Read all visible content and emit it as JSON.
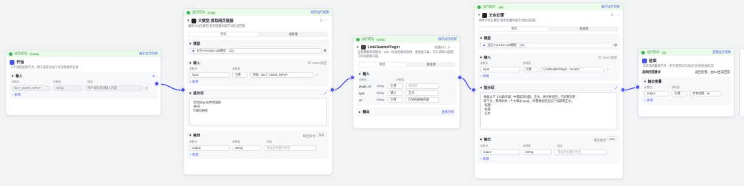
{
  "common": {
    "status": "运行成功",
    "show_result": "展示运行结果",
    "add": "新增",
    "tab_single": "单次",
    "tab_batch": "批处理",
    "col_name": "参数名",
    "col_type": "参数值",
    "col_value": "参数值",
    "col_desc": "描述",
    "inputs": "输入",
    "outputs": "输出",
    "prompt": "提示词",
    "model": "模型",
    "batch_label": "Batch类型"
  },
  "start": {
    "status_time": "0.004s",
    "title": "开始",
    "desc": "工作流的起始节点，用于设定启动工作流需要的信息",
    "section": "输入",
    "row": {
      "name": "BCT_USER_INPUT",
      "type": "String",
      "desc": "用户本轮对话输入内容"
    }
  },
  "llm1": {
    "status_time": "4.34s",
    "title": "大模型-提取网页链接",
    "desc": "调用大语言模型,使用变量和提示词生成回复",
    "model": "豆包·Function call模型",
    "model_tag": "32k",
    "input_row": {
      "name": "input",
      "mode": "引用",
      "ref": "开始 · BCT_USER_INPUT"
    },
    "prompt_text": [
      "识别{{input}}中的链接",
      "-要求:",
      "只输出链接"
    ],
    "output_label": "输出格式",
    "output_fmt": "text",
    "output_row": {
      "name": "output",
      "type": "String",
      "desc": "请描述变量的用途"
    }
  },
  "plugin": {
    "status_time": "4.03s",
    "title": "LinkReaderPlugin",
    "desc": "当你需要获取网页、pdf、抖音视频内容时，使用此工具。可以获取url链接下的标题和内容。",
    "rows": [
      {
        "name": "plugin_id",
        "type": "String",
        "val": "请选择"
      },
      {
        "name": "type",
        "type": "String",
        "val": "全文"
      },
      {
        "name": "url",
        "type": "String",
        "val": "识别的链接内容"
      }
    ],
    "output_link": "查看示例",
    "mode_label": "批量执行"
  },
  "llm2": {
    "status_time": "18s",
    "title": "文本处理",
    "desc": "调用大语言模型,使用变量和提示词生成回复",
    "model": "豆包·Function call模型",
    "model_tag": "32k",
    "input_row": {
      "name": "input",
      "mode": "引用",
      "ref": "LinkReaderPlugin - content"
    },
    "prompt_text": [
      "根据以下【文章内容】中提取其标题、正文、要点并返回，告诉我先吧",
      "除下文，我将给你一个文章{{input}}，你需要总结出这个标题和正文。",
      "",
      "-标题：",
      "-标题",
      "-正文"
    ],
    "output_label": "输出格式",
    "output_fmt": "text",
    "output_row": {
      "name": "output",
      "type": "String",
      "desc": "请描述变量的用途"
    }
  },
  "end": {
    "status_time": "0s",
    "title": "结束",
    "desc": "工作流的最终节点，用于返回工作流运行后的结果信息",
    "return_label": "选择回答模式",
    "return_val": "返回变量，由bot生成回答",
    "section": "输出变量",
    "row": {
      "name": "output",
      "mode": "引用",
      "ref": "文本处理 - ou"
    },
    "show_result": "查看运行结果"
  },
  "colors": {
    "accent": "#4d53e8",
    "success": "#28a745"
  }
}
